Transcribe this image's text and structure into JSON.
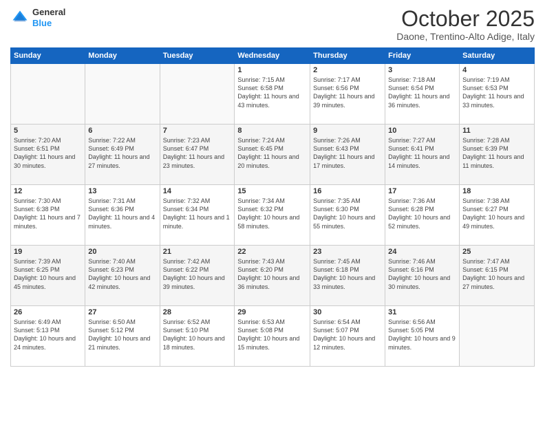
{
  "logo": {
    "general": "General",
    "blue": "Blue"
  },
  "header": {
    "month": "October 2025",
    "location": "Daone, Trentino-Alto Adige, Italy"
  },
  "weekdays": [
    "Sunday",
    "Monday",
    "Tuesday",
    "Wednesday",
    "Thursday",
    "Friday",
    "Saturday"
  ],
  "weeks": [
    [
      {
        "day": "",
        "info": ""
      },
      {
        "day": "",
        "info": ""
      },
      {
        "day": "",
        "info": ""
      },
      {
        "day": "1",
        "info": "Sunrise: 7:15 AM\nSunset: 6:58 PM\nDaylight: 11 hours\nand 43 minutes."
      },
      {
        "day": "2",
        "info": "Sunrise: 7:17 AM\nSunset: 6:56 PM\nDaylight: 11 hours\nand 39 minutes."
      },
      {
        "day": "3",
        "info": "Sunrise: 7:18 AM\nSunset: 6:54 PM\nDaylight: 11 hours\nand 36 minutes."
      },
      {
        "day": "4",
        "info": "Sunrise: 7:19 AM\nSunset: 6:53 PM\nDaylight: 11 hours\nand 33 minutes."
      }
    ],
    [
      {
        "day": "5",
        "info": "Sunrise: 7:20 AM\nSunset: 6:51 PM\nDaylight: 11 hours\nand 30 minutes."
      },
      {
        "day": "6",
        "info": "Sunrise: 7:22 AM\nSunset: 6:49 PM\nDaylight: 11 hours\nand 27 minutes."
      },
      {
        "day": "7",
        "info": "Sunrise: 7:23 AM\nSunset: 6:47 PM\nDaylight: 11 hours\nand 23 minutes."
      },
      {
        "day": "8",
        "info": "Sunrise: 7:24 AM\nSunset: 6:45 PM\nDaylight: 11 hours\nand 20 minutes."
      },
      {
        "day": "9",
        "info": "Sunrise: 7:26 AM\nSunset: 6:43 PM\nDaylight: 11 hours\nand 17 minutes."
      },
      {
        "day": "10",
        "info": "Sunrise: 7:27 AM\nSunset: 6:41 PM\nDaylight: 11 hours\nand 14 minutes."
      },
      {
        "day": "11",
        "info": "Sunrise: 7:28 AM\nSunset: 6:39 PM\nDaylight: 11 hours\nand 11 minutes."
      }
    ],
    [
      {
        "day": "12",
        "info": "Sunrise: 7:30 AM\nSunset: 6:38 PM\nDaylight: 11 hours\nand 7 minutes."
      },
      {
        "day": "13",
        "info": "Sunrise: 7:31 AM\nSunset: 6:36 PM\nDaylight: 11 hours\nand 4 minutes."
      },
      {
        "day": "14",
        "info": "Sunrise: 7:32 AM\nSunset: 6:34 PM\nDaylight: 11 hours\nand 1 minute."
      },
      {
        "day": "15",
        "info": "Sunrise: 7:34 AM\nSunset: 6:32 PM\nDaylight: 10 hours\nand 58 minutes."
      },
      {
        "day": "16",
        "info": "Sunrise: 7:35 AM\nSunset: 6:30 PM\nDaylight: 10 hours\nand 55 minutes."
      },
      {
        "day": "17",
        "info": "Sunrise: 7:36 AM\nSunset: 6:28 PM\nDaylight: 10 hours\nand 52 minutes."
      },
      {
        "day": "18",
        "info": "Sunrise: 7:38 AM\nSunset: 6:27 PM\nDaylight: 10 hours\nand 49 minutes."
      }
    ],
    [
      {
        "day": "19",
        "info": "Sunrise: 7:39 AM\nSunset: 6:25 PM\nDaylight: 10 hours\nand 45 minutes."
      },
      {
        "day": "20",
        "info": "Sunrise: 7:40 AM\nSunset: 6:23 PM\nDaylight: 10 hours\nand 42 minutes."
      },
      {
        "day": "21",
        "info": "Sunrise: 7:42 AM\nSunset: 6:22 PM\nDaylight: 10 hours\nand 39 minutes."
      },
      {
        "day": "22",
        "info": "Sunrise: 7:43 AM\nSunset: 6:20 PM\nDaylight: 10 hours\nand 36 minutes."
      },
      {
        "day": "23",
        "info": "Sunrise: 7:45 AM\nSunset: 6:18 PM\nDaylight: 10 hours\nand 33 minutes."
      },
      {
        "day": "24",
        "info": "Sunrise: 7:46 AM\nSunset: 6:16 PM\nDaylight: 10 hours\nand 30 minutes."
      },
      {
        "day": "25",
        "info": "Sunrise: 7:47 AM\nSunset: 6:15 PM\nDaylight: 10 hours\nand 27 minutes."
      }
    ],
    [
      {
        "day": "26",
        "info": "Sunrise: 6:49 AM\nSunset: 5:13 PM\nDaylight: 10 hours\nand 24 minutes."
      },
      {
        "day": "27",
        "info": "Sunrise: 6:50 AM\nSunset: 5:12 PM\nDaylight: 10 hours\nand 21 minutes."
      },
      {
        "day": "28",
        "info": "Sunrise: 6:52 AM\nSunset: 5:10 PM\nDaylight: 10 hours\nand 18 minutes."
      },
      {
        "day": "29",
        "info": "Sunrise: 6:53 AM\nSunset: 5:08 PM\nDaylight: 10 hours\nand 15 minutes."
      },
      {
        "day": "30",
        "info": "Sunrise: 6:54 AM\nSunset: 5:07 PM\nDaylight: 10 hours\nand 12 minutes."
      },
      {
        "day": "31",
        "info": "Sunrise: 6:56 AM\nSunset: 5:05 PM\nDaylight: 10 hours\nand 9 minutes."
      },
      {
        "day": "",
        "info": ""
      }
    ]
  ]
}
